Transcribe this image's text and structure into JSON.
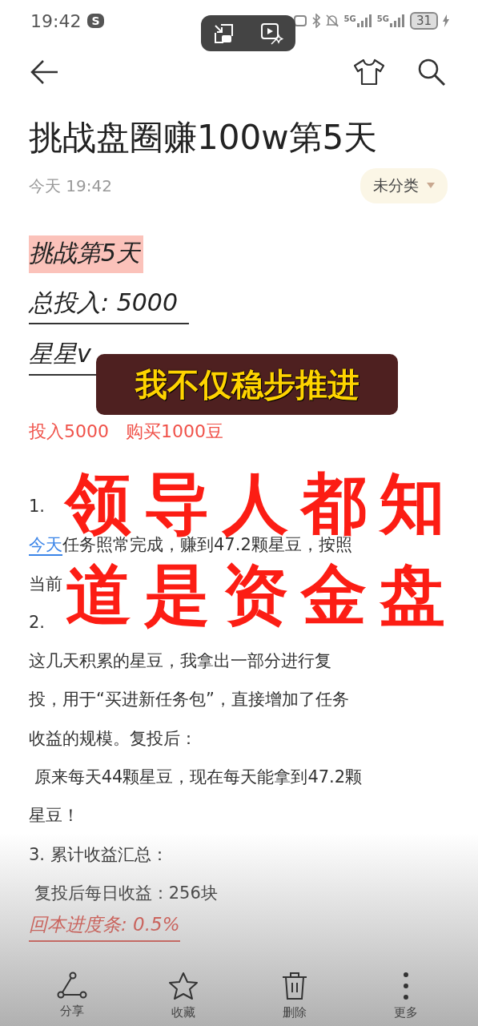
{
  "status_bar": {
    "time": "19:42",
    "app_badge": "S",
    "signals": [
      "5G",
      "5G"
    ],
    "battery": "31"
  },
  "title": "挑战盘圈赚100w第5天",
  "date": "今天 19:42",
  "category": "未分类",
  "body": [
    {
      "kind": "highlight",
      "text": "挑战第5天"
    },
    {
      "kind": "underlined",
      "text": "总投入: 5000"
    },
    {
      "kind": "underlined",
      "text": "星星v"
    },
    {
      "kind": "red",
      "text": "投入5000   购买1000豆"
    },
    {
      "kind": "covered",
      "parts": [
        "1."
      ]
    },
    {
      "kind": "link",
      "link": "今天",
      "text": "任务照常完成，赚到47.2颗星豆，按照"
    },
    {
      "kind": "covered",
      "parts": [
        "当前"
      ]
    },
    {
      "kind": "covered",
      "parts": [
        "2."
      ]
    },
    {
      "kind": "text",
      "text": "这几天积累的星豆，我拿出一部分进行复"
    },
    {
      "kind": "text",
      "text": "投，用于“买进新任务包”，直接增加了任务"
    },
    {
      "kind": "text",
      "text": "收益的规模。复投后："
    },
    {
      "kind": "text",
      "text": " 原来每天44颗星豆，现在每天能拿到47.2颗"
    },
    {
      "kind": "text",
      "text": "星豆！"
    },
    {
      "kind": "text",
      "text": "3. 累计收益汇总："
    },
    {
      "kind": "text",
      "text": " 复投后每日收益：256块"
    },
    {
      "kind": "red_underlined",
      "text": "回本进度条: 0.5%"
    }
  ],
  "captions": [
    {
      "kind": "subtitle",
      "text": "我不仅稳步推进"
    },
    {
      "kind": "headline",
      "text": "领导人都知"
    },
    {
      "kind": "headline",
      "text": "道是资金盘"
    }
  ],
  "toolbar": [
    {
      "kind": "share",
      "label": "分享"
    },
    {
      "kind": "star",
      "label": "收藏"
    },
    {
      "kind": "trash",
      "label": "删除"
    },
    {
      "kind": "more",
      "label": "更多"
    }
  ]
}
